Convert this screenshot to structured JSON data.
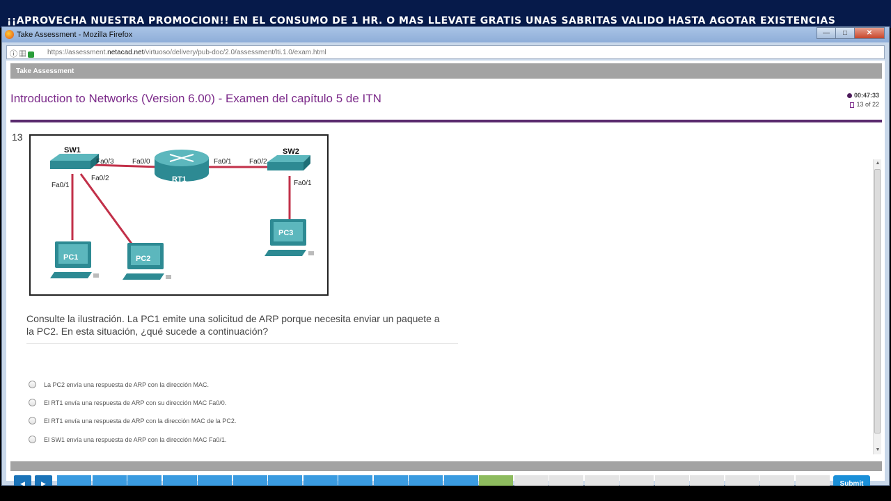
{
  "promo_banner": "¡¡APROVECHA NUESTRA PROMOCION!! EN EL CONSUMO DE 1 HR. O MAS LLEVATE GRATIS UNAS SABRITAS VALIDO HASTA AGOTAR EXISTENCIAS",
  "window": {
    "title": "Take Assessment - Mozilla Firefox",
    "minimize": "—",
    "maximize": "□",
    "close": "✕"
  },
  "urlbar": {
    "prefix": "https://assessment.",
    "domain": "netacad.net",
    "path": "/virtuoso/delivery/pub-doc/2.0/assessment/lti.1.0/exam.html"
  },
  "header": {
    "label": "Take Assessment"
  },
  "exam": {
    "title": "Introduction to Networks (Version 6.00) - Examen del capítulo 5 de ITN",
    "timer": "00:47:33",
    "page_indicator": "13 of 22"
  },
  "question": {
    "number": "13",
    "text": "Consulte la ilustración. La PC1 emite una solicitud de ARP porque necesita enviar un paquete a la PC2. En esta situación, ¿qué sucede a continuación?",
    "options": [
      "La PC2 envía una respuesta de ARP con la dirección MAC.",
      "El RT1 envía una respuesta de ARP con su dirección MAC Fa0/0.",
      "El RT1 envía una respuesta de ARP con la dirección MAC de la PC2.",
      "El SW1 envía una respuesta de ARP con la dirección MAC Fa0/1."
    ]
  },
  "diagram": {
    "sw1": "SW1",
    "sw2": "SW2",
    "rt1": "RT1",
    "pc1": "PC1",
    "pc2": "PC2",
    "pc3": "PC3",
    "ports": {
      "sw1_fa03": "Fa0/3",
      "sw1_fa01": "Fa0/1",
      "sw1_fa02": "Fa0/2",
      "rt1_fa00": "Fa0/0",
      "rt1_fa01": "Fa0/1",
      "sw2_fa02": "Fa0/2",
      "sw2_fa01": "Fa0/1"
    }
  },
  "navigation": {
    "prev": "◀",
    "next": "▶",
    "submit": "Submit",
    "total_questions": 22,
    "answered": 12,
    "current": 13
  },
  "colors": {
    "accent_purple": "#7c2b8a",
    "progress_done": "#3a9be0",
    "progress_current": "#8dbb5e",
    "cable_red": "#c23049",
    "device_teal": "#2d8a93"
  }
}
